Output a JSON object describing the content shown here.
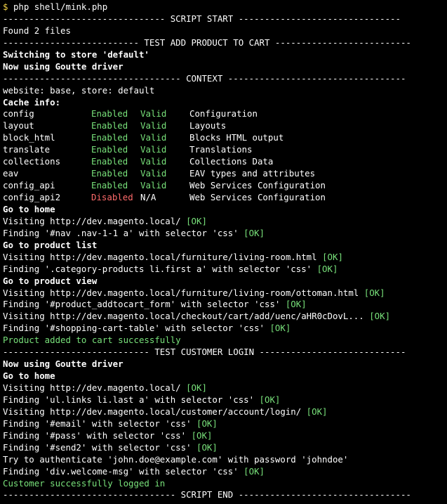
{
  "prompt": {
    "symbol": "$",
    "command": "php shell/mink.php"
  },
  "sections": {
    "script_start": "------------------------------- SCRIPT START -------------------------------",
    "test_add": "-------------------------- TEST ADD PRODUCT TO CART --------------------------",
    "context": "---------------------------------- CONTEXT ----------------------------------",
    "test_login": "---------------------------- TEST CUSTOMER LOGIN ----------------------------",
    "script_end": "--------------------------------- SCRIPT END ---------------------------------"
  },
  "lines": {
    "found_files": "Found 2 files",
    "switch_store": "Switching to store 'default'",
    "goutte1": "Now using Goutte driver",
    "website": "website: base, store: default",
    "cache_info": "Cache info:",
    "go_home1": "Go to home",
    "visit1": "Visiting http://dev.magento.local/ ",
    "find1": "Finding '#nav .nav-1-1 a' with selector 'css' ",
    "go_list": "Go to product list",
    "visit2": "Visiting http://dev.magento.local/furniture/living-room.html ",
    "find2": "Finding '.category-products li.first a' with selector 'css' ",
    "go_view": "Go to product view",
    "visit3": "Visiting http://dev.magento.local/furniture/living-room/ottoman.html ",
    "find3": "Finding '#product_addtocart_form' with selector 'css' ",
    "visit4": "Visiting http://dev.magento.local/checkout/cart/add/uenc/aHR0cDovL... ",
    "find4": "Finding '#shopping-cart-table' with selector 'css' ",
    "added": "Product added to cart successfully",
    "goutte2": "Now using Goutte driver",
    "go_home2": "Go to home",
    "visit5": "Visiting http://dev.magento.local/ ",
    "find5": "Finding 'ul.links li.last a' with selector 'css' ",
    "visit6": "Visiting http://dev.magento.local/customer/account/login/ ",
    "find6": "Finding '#email' with selector 'css' ",
    "find7": "Finding '#pass' with selector 'css' ",
    "find8": "Finding '#send2' with selector 'css' ",
    "auth": "Try to authenticate 'john.doe@example.com' with password 'johndoe'",
    "find9": "Finding 'div.welcome-msg' with selector 'css' ",
    "logged_in": "Customer successfully logged in"
  },
  "ok": "[OK]",
  "cache": [
    {
      "name": "config",
      "status": "Enabled",
      "valid": "Valid",
      "desc": "Configuration"
    },
    {
      "name": "layout",
      "status": "Enabled",
      "valid": "Valid",
      "desc": "Layouts"
    },
    {
      "name": "block_html",
      "status": "Enabled",
      "valid": "Valid",
      "desc": "Blocks HTML output"
    },
    {
      "name": "translate",
      "status": "Enabled",
      "valid": "Valid",
      "desc": "Translations"
    },
    {
      "name": "collections",
      "status": "Enabled",
      "valid": "Valid",
      "desc": "Collections Data"
    },
    {
      "name": "eav",
      "status": "Enabled",
      "valid": "Valid",
      "desc": "EAV types and attributes"
    },
    {
      "name": "config_api",
      "status": "Enabled",
      "valid": "Valid",
      "desc": "Web Services Configuration"
    },
    {
      "name": "config_api2",
      "status": "Disabled",
      "valid": "N/A",
      "desc": "Web Services Configuration"
    }
  ],
  "colors": {
    "background": "#000000",
    "text": "#e4e4e4",
    "success": "#78e17a",
    "error": "#ff6b6b",
    "prompt": "#f5d547"
  }
}
